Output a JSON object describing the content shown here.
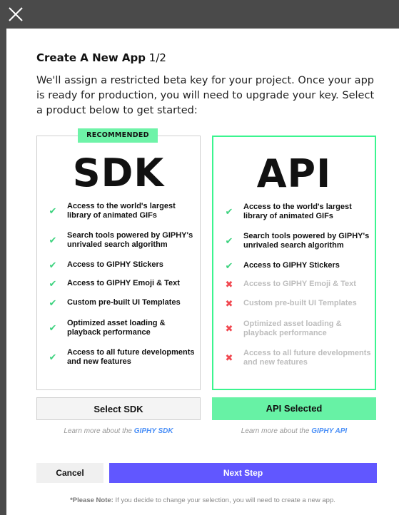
{
  "dialog": {
    "close_icon": "close-icon",
    "title_strong": "Create A New App",
    "title_step": "1/2",
    "intro": "We'll assign a restricted beta key for your project. Once your app is ready for production, you will need to upgrade your key. Select a product below to get started:"
  },
  "sdk": {
    "badge": "RECOMMENDED",
    "name": "SDK",
    "features": [
      {
        "text": "Access to the world's largest library of animated GIFs",
        "included": true
      },
      {
        "text": "Search tools powered by GIPHY's unrivaled search algorithm",
        "included": true
      },
      {
        "text": "Access to GIPHY Stickers",
        "included": true
      },
      {
        "text": "Access to GIPHY Emoji & Text",
        "included": true
      },
      {
        "text": "Custom pre-built UI Templates",
        "included": true
      },
      {
        "text": "Optimized asset loading & playback performance",
        "included": true
      },
      {
        "text": "Access to all future developments and new features",
        "included": true
      }
    ],
    "button": "Select SDK",
    "learn_prefix": "Learn more about the ",
    "learn_link": "GIPHY SDK"
  },
  "api": {
    "name": "API",
    "selected": true,
    "features": [
      {
        "text": "Access to the world's largest library of animated GIFs",
        "included": true
      },
      {
        "text": "Search tools powered by GIPHY's unrivaled search algorithm",
        "included": true
      },
      {
        "text": "Access to GIPHY Stickers",
        "included": true
      },
      {
        "text": "Access to GIPHY Emoji & Text",
        "included": false
      },
      {
        "text": "Custom pre-built UI Templates",
        "included": false
      },
      {
        "text": "Optimized asset loading & playback performance",
        "included": false
      },
      {
        "text": "Access to all future developments and new features",
        "included": false
      }
    ],
    "button": "API Selected",
    "learn_prefix": "Learn more about the ",
    "learn_link": "GIPHY API"
  },
  "footer": {
    "cancel": "Cancel",
    "next": "Next Step",
    "note_label": "*Please Note:",
    "note_text": " If you decide to change your selection, you will need to create a new app."
  },
  "colors": {
    "accent_green": "#3bf58f",
    "check_green": "#3fd380",
    "x_red": "#f1474f",
    "next_purple": "#6157ff",
    "link_blue": "#4a8ff7"
  }
}
